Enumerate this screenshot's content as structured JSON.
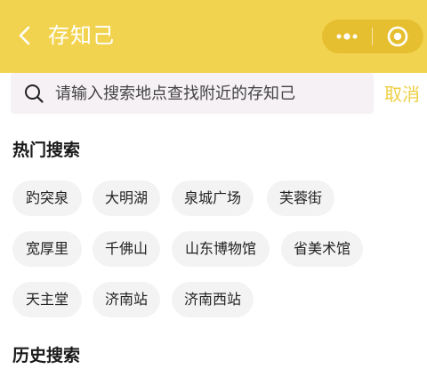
{
  "header": {
    "title": "存知己",
    "background": "#f2d34f"
  },
  "search": {
    "placeholder": "请输入搜索地点查找附近的存知己",
    "cancel_label": "取消"
  },
  "hot_search": {
    "title": "热门搜索",
    "tags": [
      "趵突泉",
      "大明湖",
      "泉城广场",
      "芙蓉街",
      "宽厚里",
      "千佛山",
      "山东博物馆",
      "省美术馆",
      "天主堂",
      "济南站",
      "济南西站"
    ]
  },
  "history_search": {
    "title": "历史搜索"
  },
  "icons": {
    "back": "chevron-left-icon",
    "more": "more-dots-icon",
    "close": "target-circle-icon",
    "search": "search-icon"
  }
}
